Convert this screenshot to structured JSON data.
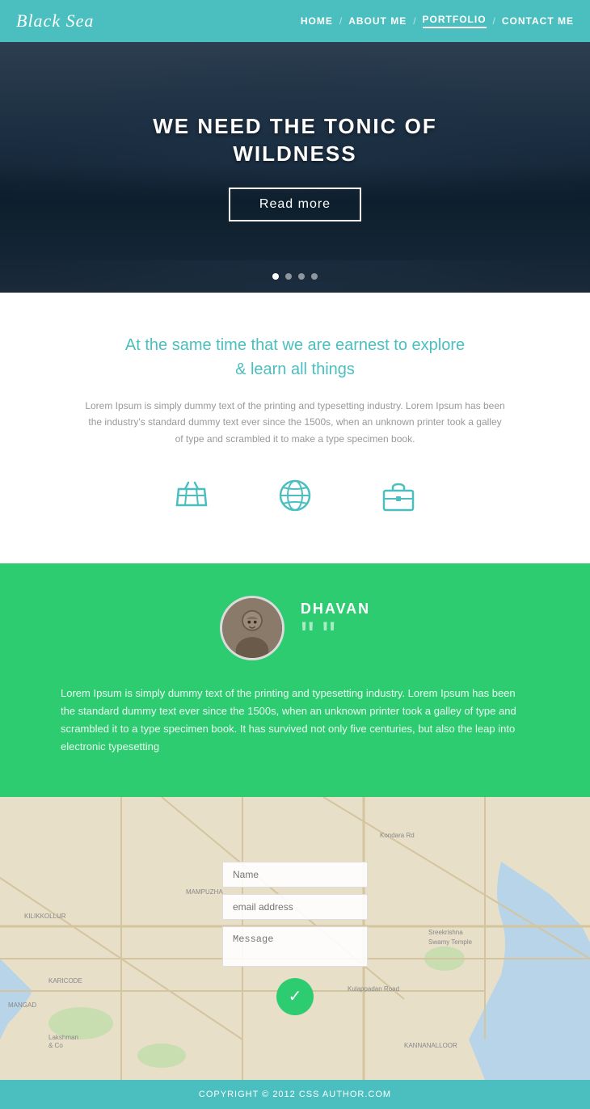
{
  "header": {
    "logo": "Black Sea",
    "nav": [
      {
        "label": "HOME",
        "active": false
      },
      {
        "label": "ABOUT ME",
        "active": false
      },
      {
        "label": "PORTFOLIO",
        "active": true
      },
      {
        "label": "CONTACT ME",
        "active": false
      }
    ]
  },
  "hero": {
    "title_line1": "WE NEED THE TONIC OF",
    "title_line2": "WILDNESS",
    "cta_button": "Read more",
    "dots": [
      true,
      false,
      false,
      false
    ]
  },
  "about": {
    "headline_line1": "At the same time that we are earnest to explore",
    "headline_line2": "& learn all things",
    "body_text": "Lorem Ipsum is simply dummy text of the printing and typesetting industry. Lorem Ipsum has been the industry's standard dummy text ever since the 1500s, when an unknown printer took a galley of type and scrambled it to make a type specimen book.",
    "icons": [
      {
        "name": "basket-icon"
      },
      {
        "name": "globe-icon"
      },
      {
        "name": "briefcase-icon"
      }
    ]
  },
  "testimonial": {
    "name": "DHAVAN",
    "quote_mark": "””",
    "text": "Lorem Ipsum is simply dummy text of the printing and typesetting industry. Lorem Ipsum has been the standard dummy text ever since the 1500s, when an unknown printer took a galley of type and scrambled it to a type specimen book. It has survived not only five centuries, but also the leap into electronic typesetting"
  },
  "contact": {
    "name_placeholder": "Name",
    "email_placeholder": "email address",
    "message_placeholder": "Message"
  },
  "footer": {
    "copyright": "COPYRIGHT © 2012 CSS AUTHOR.COM"
  },
  "colors": {
    "teal": "#4bbfbf",
    "green": "#2ecc71",
    "dark_hero": "#1a2a3a"
  }
}
